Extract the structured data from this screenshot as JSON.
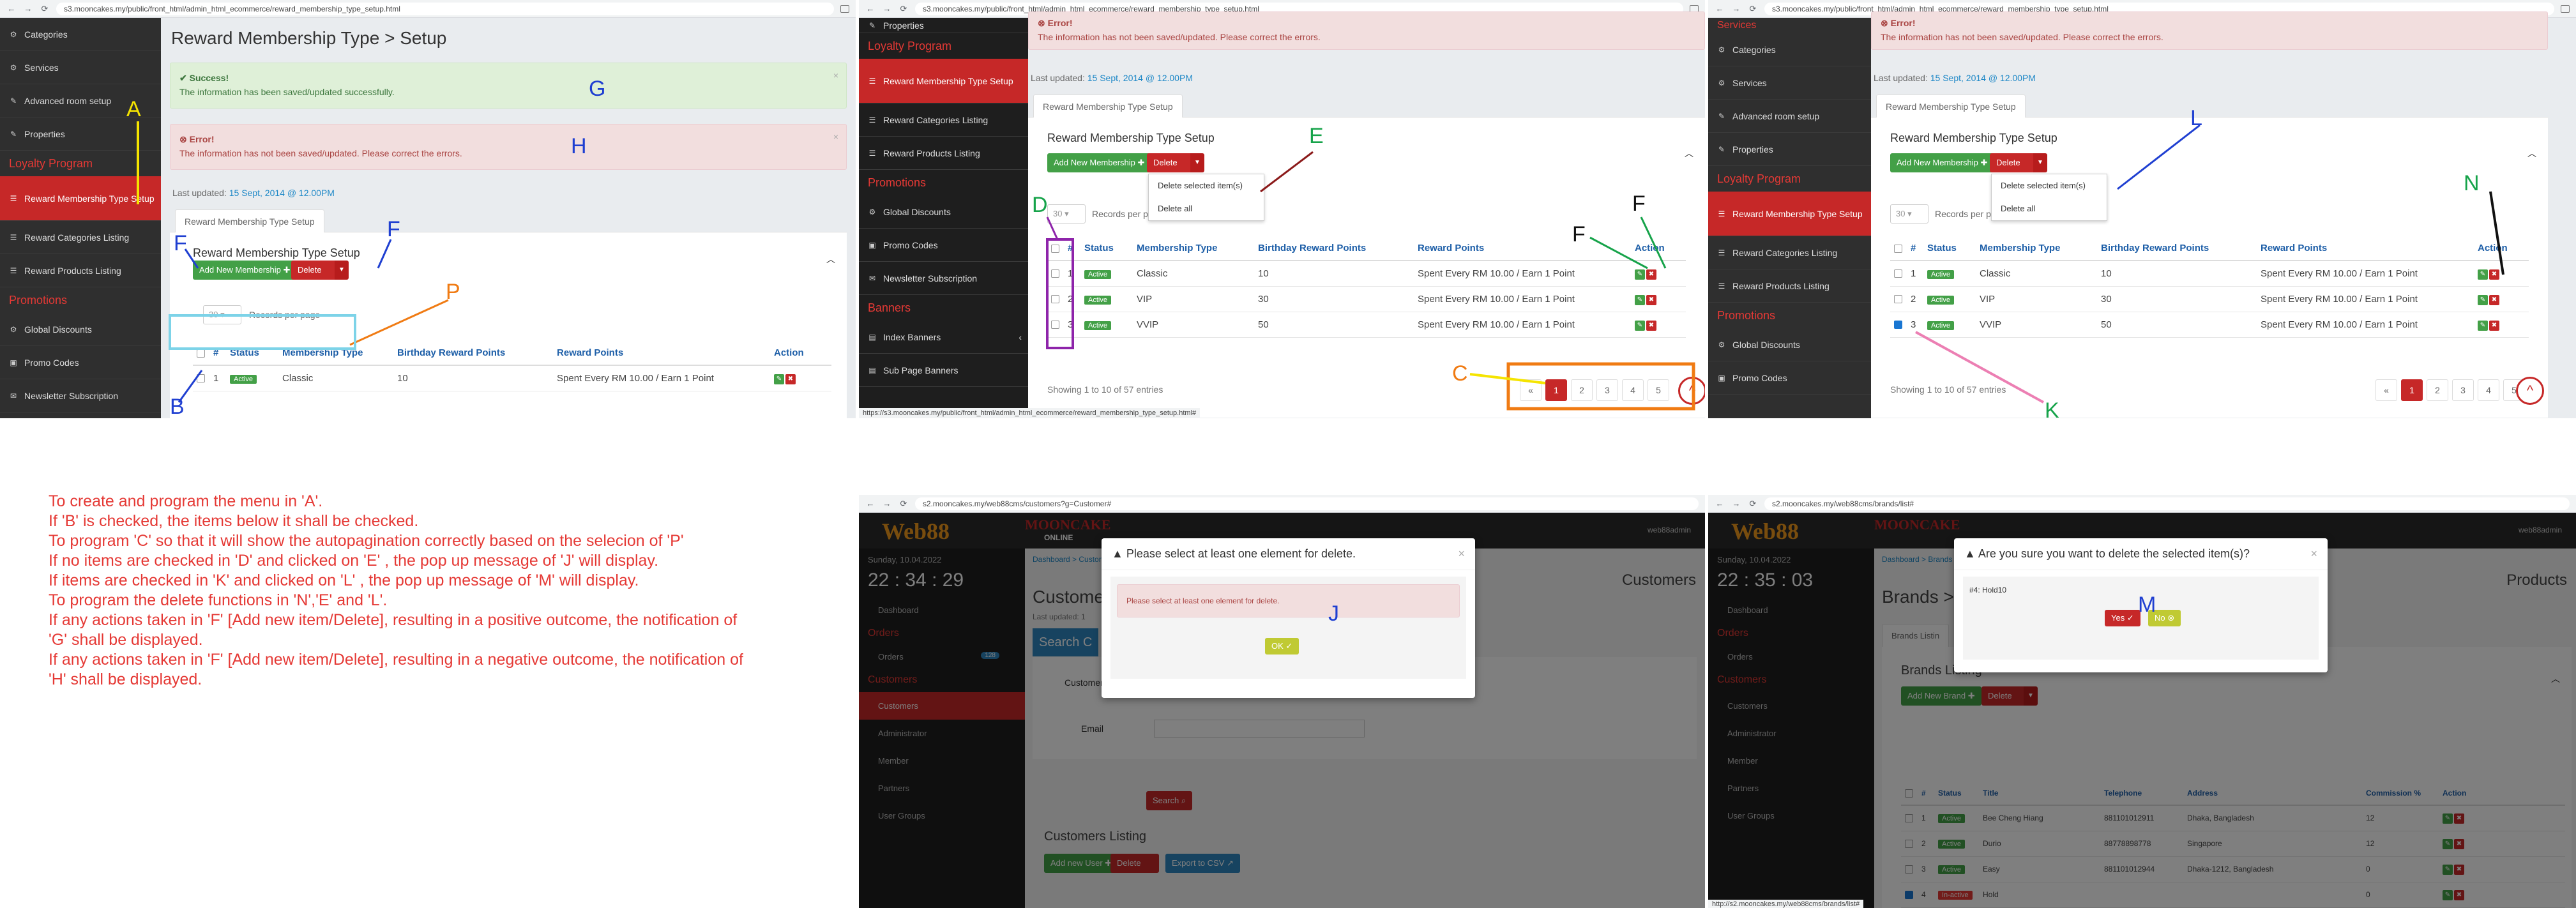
{
  "common": {
    "brand_title": "Reward Membership Type > Setup",
    "tab_label": "Reward Membership Type Setup",
    "box_title": "Reward Membership Type Setup",
    "add_btn": "Add New Membership",
    "add_btn_cut": "Add New Membership",
    "delete_btn": "Delete",
    "select_value": "30",
    "records_per_page": "Records per page",
    "records_cut": "Records per p",
    "last_updated_label": "Last updated:",
    "last_updated_value": "15 Sept, 2014 @ 12.00PM",
    "success_title": "Success!",
    "success_msg": "The information has been saved/updated successfully.",
    "error_title": "Error!",
    "error_msg": "The information has not been saved/updated. Please correct the errors.",
    "showing": "Showing 1 to 10 of 57 entries",
    "delete_selected": "Delete selected item(s)",
    "delete_all": "Delete all",
    "columns": [
      "#",
      "Status",
      "Membership Type",
      "Birthday Reward Points",
      "Reward Points",
      "Action"
    ],
    "rows": [
      {
        "n": "1",
        "status": "Active",
        "type": "Classic",
        "bday": "10",
        "points": "Spent Every RM 10.00 / Earn 1 Point"
      },
      {
        "n": "2",
        "status": "Active",
        "type": "VIP",
        "bday": "30",
        "points": "Spent Every RM 10.00 / Earn 1 Point"
      },
      {
        "n": "3",
        "status": "Active",
        "type": "VVIP",
        "bday": "50",
        "points": "Spent Every RM 10.00 / Earn 1 Point"
      }
    ],
    "pages": [
      "1",
      "2",
      "3",
      "4",
      "5"
    ],
    "prev": "«"
  },
  "urls": {
    "p1": "s3.mooncakes.my/public/front_html/admin_html_ecommerce/reward_membership_type_setup.html",
    "p2": "s3.mooncakes.my/public/front_html/admin_html_ecommerce/reward_membership_type_setup.html",
    "p3": "s3.mooncakes.my/public/front_html/admin_html_ecommerce/reward_membership_type_setup.html",
    "p4": "s2.mooncakes.my/web88cms/customers?g=Customer#",
    "p5": "s2.mooncakes.my/web88cms/brands/list#",
    "status2": "https://s3.mooncakes.my/public/front_html/admin_html_ecommerce/reward_membership_type_setup.html#",
    "status5": "http://s2.mooncakes.my/web88cms/brands/list#"
  },
  "sidebar1": {
    "items": [
      "Categories",
      "Services",
      "Advanced room setup",
      "Properties"
    ],
    "section1": "Loyalty Program",
    "active": "Reward Membership Type Setup",
    "items2": [
      "Reward Categories Listing",
      "Reward Products Listing"
    ],
    "section2": "Promotions",
    "items3": [
      "Global Discounts",
      "Promo Codes",
      "Newsletter Subscription"
    ]
  },
  "sidebar2": {
    "top": "Properties",
    "section1": "Loyalty Program",
    "active": "Reward Membership Type Setup",
    "items2": [
      "Reward Categories Listing",
      "Reward Products Listing"
    ],
    "section2": "Promotions",
    "items3": [
      "Global Discounts",
      "Promo Codes",
      "Newsletter Subscription"
    ],
    "section3": "Banners",
    "items4": [
      "Index Banners",
      "Sub Page Banners"
    ]
  },
  "sidebar3": {
    "top": "Services",
    "items": [
      "Categories",
      "Services",
      "Advanced room setup",
      "Properties"
    ],
    "section1": "Loyalty Program",
    "active": "Reward Membership Type Setup",
    "items2": [
      "Reward Categories Listing",
      "Reward Products Listing"
    ],
    "section2": "Promotions",
    "items3": [
      "Global Discounts",
      "Promo Codes"
    ]
  },
  "cms": {
    "date": "Sunday, 10.04.2022",
    "time4": "22 : 34 : 29",
    "time5": "22 : 35 : 03",
    "menu": [
      "Dashboard",
      "Orders",
      "Orders",
      "Customers",
      "Customers",
      "Administrator",
      "Member",
      "Partners",
      "User Groups"
    ],
    "orders_count": "128",
    "user": "web88admin",
    "breadcrumb4": "Dashboard > Customers",
    "breadcrumb5": "Dashboard > Brands",
    "customers_title": "Customers",
    "customers_title_cut": "Custome",
    "last_updated_cut": "Last updated: 1",
    "search_cut": "Search C",
    "customer_name": "Customer Name",
    "email": "Email",
    "search_btn": "Search",
    "customers_listing": "Customers Listing",
    "add_new_user": "Add new User",
    "export": "Export to CSV",
    "products_cut": "Products",
    "brands_cut": "Brands >",
    "brands_tab_cut": "Brands Listin",
    "brands_listing": "Brands Listing",
    "add_brand": "Add New Brand",
    "brand_cols": [
      "#",
      "Status",
      "Title",
      "Telephone",
      "Address",
      "Commission %",
      "Action"
    ],
    "brand_rows": [
      {
        "n": "1",
        "status": "Active",
        "title": "Bee Cheng Hiang",
        "tel": "881101012911",
        "addr": "Dhaka, Bangladesh",
        "comm": "12"
      },
      {
        "n": "2",
        "status": "Active",
        "title": "Durio",
        "tel": "88778898778",
        "addr": "Singapore",
        "comm": "12"
      },
      {
        "n": "3",
        "status": "Active",
        "title": "Easy",
        "tel": "881101012944",
        "addr": "Dhaka-1212, Bangladesh",
        "comm": "0"
      },
      {
        "n": "4",
        "status": "In-active",
        "title": "Hold",
        "tel": "",
        "addr": "",
        "comm": "0"
      }
    ],
    "modal_j_title": "Please select at least one element for delete.",
    "modal_j_msg": "Please select at least one element for delete.",
    "modal_j_ok": "OK",
    "modal_m_title": "Are you sure you want to delete the selected item(s)?",
    "modal_m_item": "#4: Hold10",
    "modal_m_yes": "Yes",
    "modal_m_no": "No",
    "logo_main": "Web88",
    "logo_sub": "MOONCAKE",
    "logo_online": "ONLINE"
  },
  "marks": {
    "A": "A",
    "B": "B",
    "C": "C",
    "D": "D",
    "E": "E",
    "F": "F",
    "G": "G",
    "H": "H",
    "J": "J",
    "K": "K",
    "L": "L",
    "M": "M",
    "N": "N",
    "P": "P"
  },
  "instructions": [
    "To create and program the menu in 'A'.",
    "If 'B' is checked, the items below it shall be checked.",
    "To program 'C' so that it will show the autopagination correctly based  on the selecion of 'P'",
    "If no items are checked in 'D' and clicked on 'E' , the pop up message  of 'J' will display.",
    "If items are checked in 'K' and clicked on 'L' , the pop up message of  'M' will display.",
    "To program the delete functions in 'N','E' and 'L'.",
    "If any actions taken in 'F' [Add new item/Delete], resulting in a  positive outcome, the notification of",
    "'G' shall be displayed.",
    "If any actions taken in 'F' [Add new item/Delete], resulting in a  negative outcome, the notification of",
    "'H' shall be displayed."
  ],
  "colors": {
    "accent_red": "#c62828",
    "annot_yellow": "#f5e400",
    "annot_blue": "#1f3fd1",
    "annot_orange": "#f07b13",
    "annot_green": "#16a34a",
    "annot_purple": "#8e24aa",
    "annot_pink": "#ec7fb3",
    "annot_teal": "#7dd3e8",
    "annot_darkred": "#8b1a1a",
    "annot_black": "#111111"
  }
}
